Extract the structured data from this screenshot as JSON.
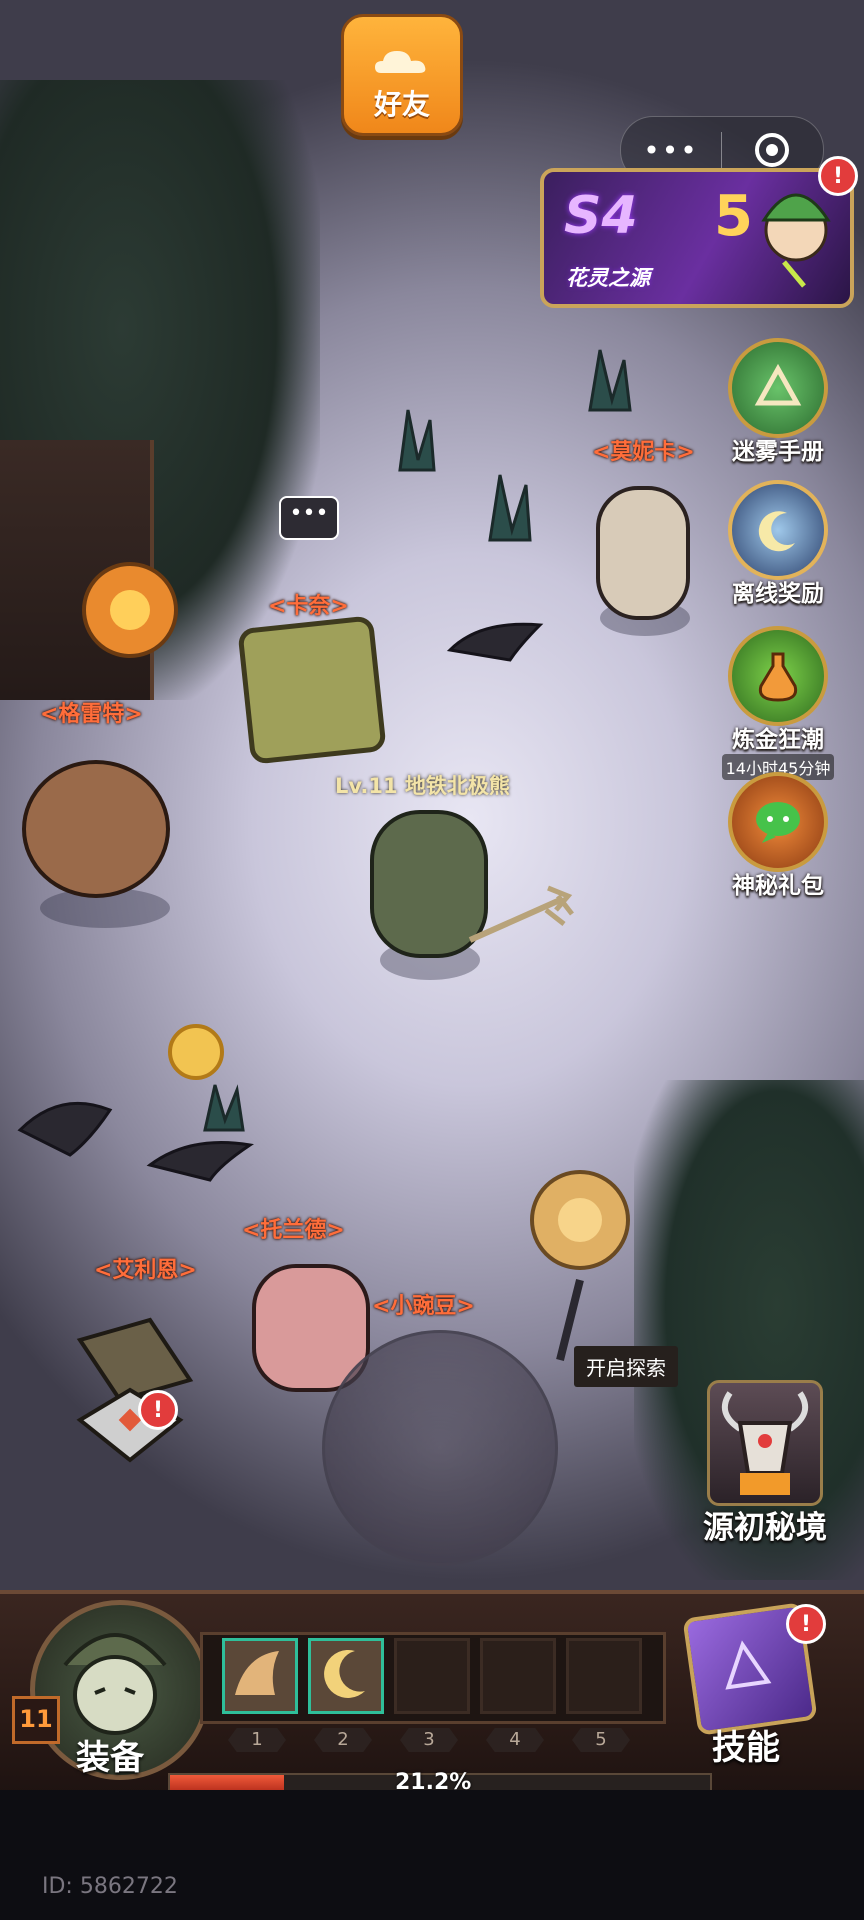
{
  "top": {
    "friend_button_label": "好友",
    "capsule_dots": "•••"
  },
  "event_banner": {
    "season": "S4",
    "season_number": "5",
    "subtitle": "花灵之源"
  },
  "side_menu": [
    {
      "label": "迷雾手册",
      "icon": "compass-book-icon",
      "alert": false
    },
    {
      "label": "离线奖励",
      "icon": "moon-sun-icon",
      "alert": false
    },
    {
      "label": "炼金狂潮",
      "icon": "potion-icon",
      "timer": "14小时45分钟",
      "alert": false
    },
    {
      "label": "神秘礼包",
      "icon": "chat-gift-icon",
      "alert": false
    }
  ],
  "npcs": {
    "monica": "<莫妮卡>",
    "kana": "<卡奈>",
    "gret": "<格雷特>",
    "toland": "<托兰德>",
    "ellien": "<艾利恩>",
    "pea": "<小豌豆>"
  },
  "hero": {
    "label": "Lv.11 地铁北极熊",
    "speech": "•••"
  },
  "explore": {
    "tag": "开启探索",
    "portal_label": "源初秘境"
  },
  "hud": {
    "equip_label": "装备",
    "skill_label": "技能",
    "level": "11",
    "slots": [
      "1",
      "2",
      "3",
      "4",
      "5"
    ],
    "xp_percent": 21.2,
    "xp_text": "21.2%"
  },
  "footer": {
    "id_text": "ID: 5862722"
  },
  "colors": {
    "npc_name": "#ff6d3a",
    "friend_button": "#f0871a",
    "alert": "#e23c3c"
  }
}
